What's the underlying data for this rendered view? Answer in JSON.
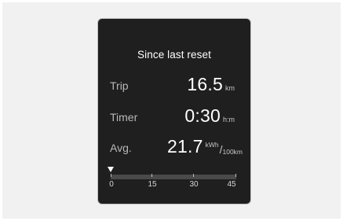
{
  "display": {
    "title": "Since last reset",
    "rows": [
      {
        "label": "Trip",
        "value": "16.5",
        "unit": "km"
      },
      {
        "label": "Timer",
        "value": "0:30",
        "unit": "h:m"
      },
      {
        "label": "Avg.",
        "value": "21.7",
        "unit_top": "kWh",
        "unit_slash": "/",
        "unit_bottom": "100km"
      }
    ],
    "scale": {
      "ticks": [
        "0",
        "15",
        "30",
        "45"
      ],
      "pointer_value": 0
    }
  },
  "colors": {
    "screen_background": "#1f1f1f",
    "text_primary": "#ffffff",
    "text_secondary": "#b9b9b9",
    "scale_track": "#4a4a4a"
  }
}
